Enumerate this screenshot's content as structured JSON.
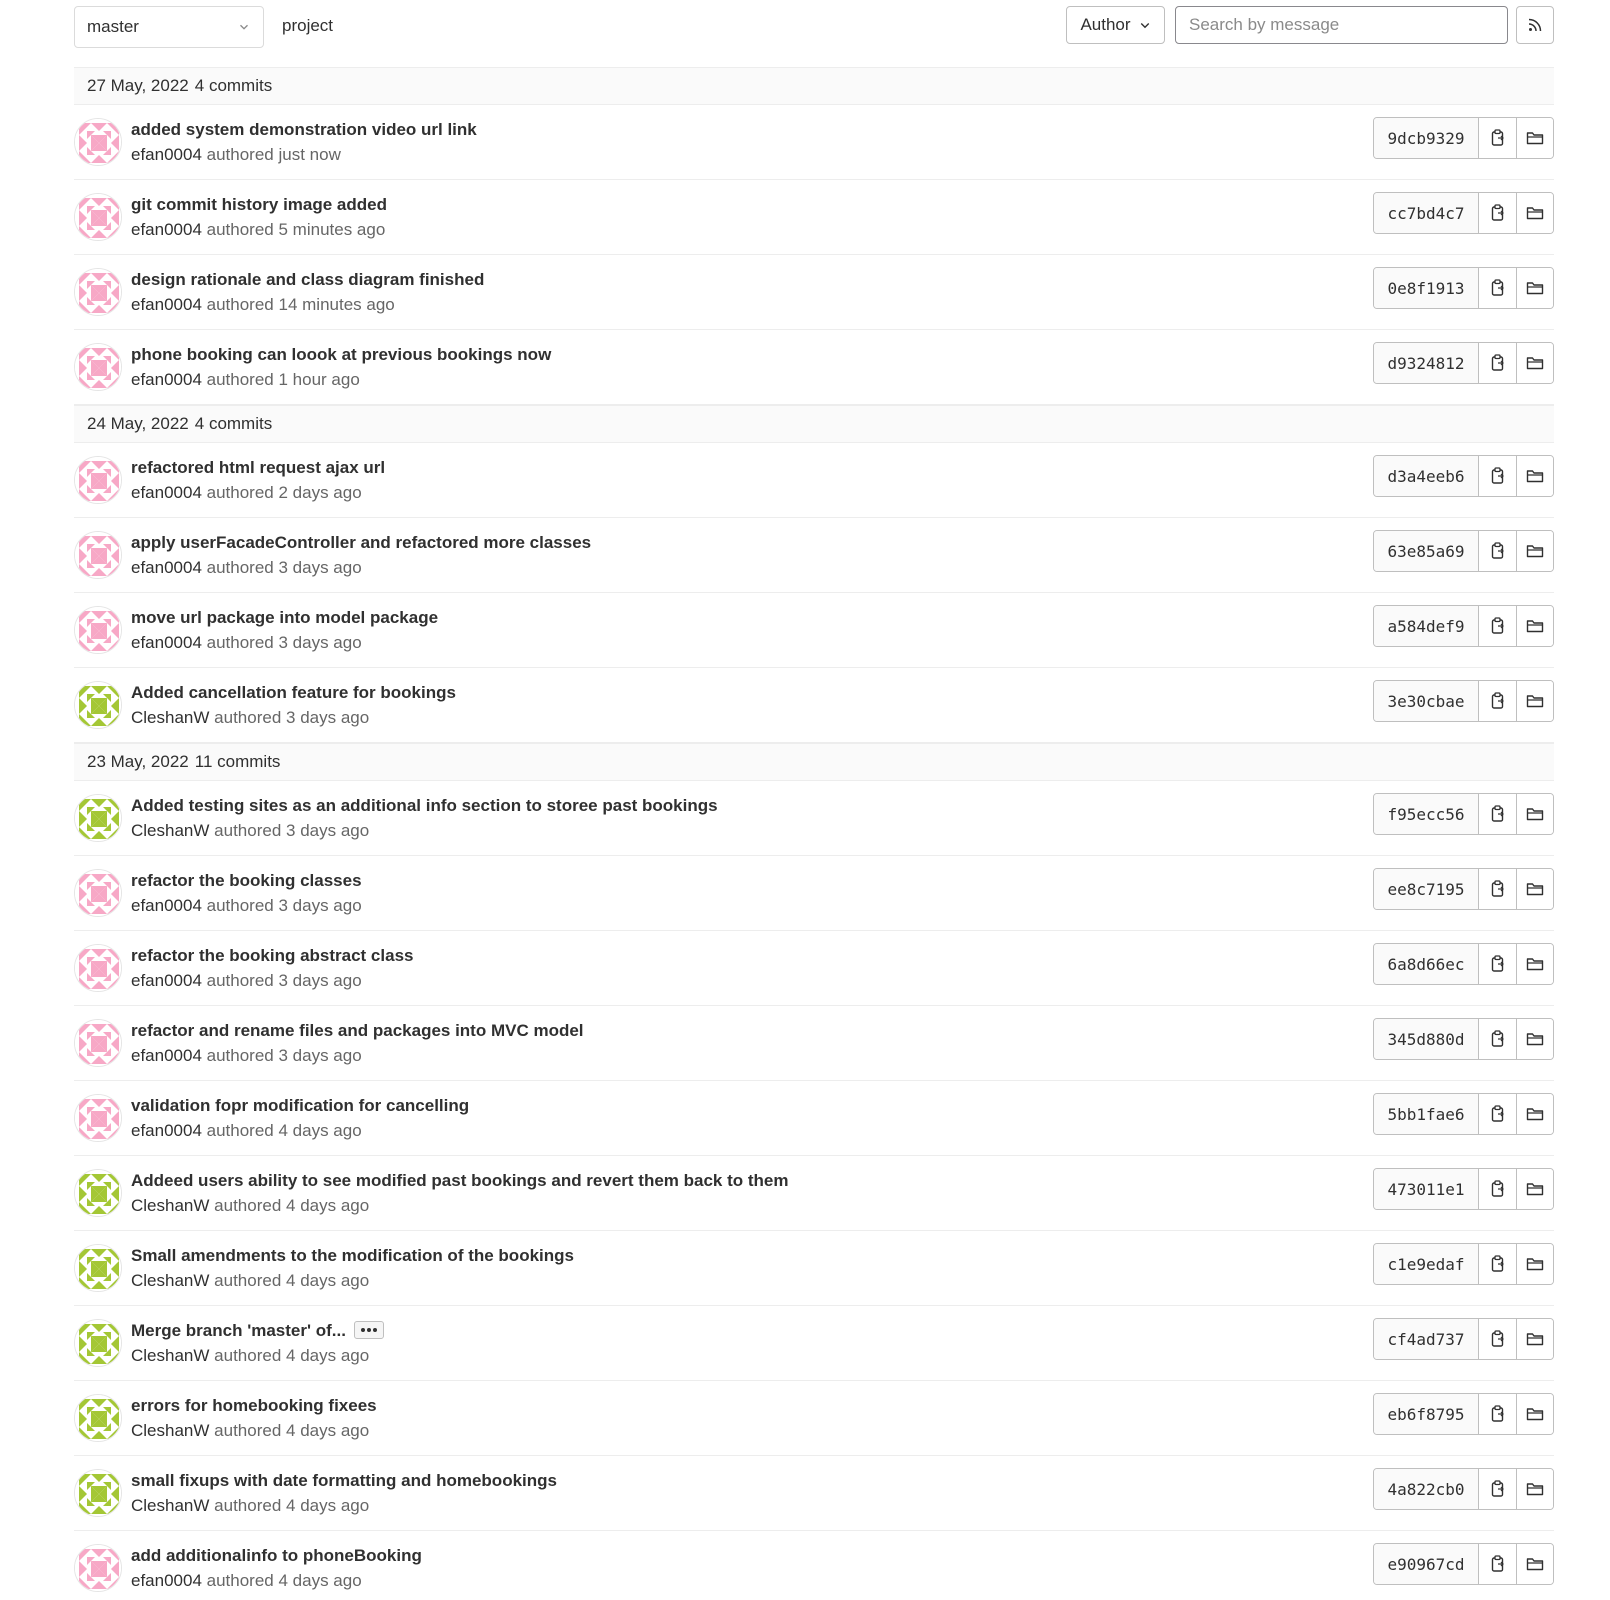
{
  "toolbar": {
    "branch": "master",
    "breadcrumb": "project",
    "author_label": "Author",
    "search_placeholder": "Search by message"
  },
  "colors": {
    "pink_avatar": "#f7a8c6",
    "green_avatar": "#a4c735"
  },
  "days": [
    {
      "date": "27 May, 2022",
      "count": "4 commits",
      "commits": [
        {
          "message": "added system demonstration video url link",
          "author": "efan0004",
          "verb": "authored",
          "time": "just now",
          "sha": "9dcb9329",
          "avatar": "pink"
        },
        {
          "message": "git commit history image added",
          "author": "efan0004",
          "verb": "authored",
          "time": "5 minutes ago",
          "sha": "cc7bd4c7",
          "avatar": "pink"
        },
        {
          "message": "design rationale and class diagram finished",
          "author": "efan0004",
          "verb": "authored",
          "time": "14 minutes ago",
          "sha": "0e8f1913",
          "avatar": "pink"
        },
        {
          "message": "phone booking can loook at previous bookings now",
          "author": "efan0004",
          "verb": "authored",
          "time": "1 hour ago",
          "sha": "d9324812",
          "avatar": "pink"
        }
      ]
    },
    {
      "date": "24 May, 2022",
      "count": "4 commits",
      "commits": [
        {
          "message": "refactored html request ajax url",
          "author": "efan0004",
          "verb": "authored",
          "time": "2 days ago",
          "sha": "d3a4eeb6",
          "avatar": "pink"
        },
        {
          "message": "apply userFacadeController and refactored more classes",
          "author": "efan0004",
          "verb": "authored",
          "time": "3 days ago",
          "sha": "63e85a69",
          "avatar": "pink"
        },
        {
          "message": "move url package into model package",
          "author": "efan0004",
          "verb": "authored",
          "time": "3 days ago",
          "sha": "a584def9",
          "avatar": "pink"
        },
        {
          "message": "Added cancellation feature for bookings",
          "author": "CleshanW",
          "verb": "authored",
          "time": "3 days ago",
          "sha": "3e30cbae",
          "avatar": "green"
        }
      ]
    },
    {
      "date": "23 May, 2022",
      "count": "11 commits",
      "commits": [
        {
          "message": "Added testing sites as an additional info section to storee past bookings",
          "author": "CleshanW",
          "verb": "authored",
          "time": "3 days ago",
          "sha": "f95ecc56",
          "avatar": "green"
        },
        {
          "message": "refactor the booking classes",
          "author": "efan0004",
          "verb": "authored",
          "time": "3 days ago",
          "sha": "ee8c7195",
          "avatar": "pink"
        },
        {
          "message": "refactor the booking abstract class",
          "author": "efan0004",
          "verb": "authored",
          "time": "3 days ago",
          "sha": "6a8d66ec",
          "avatar": "pink"
        },
        {
          "message": "refactor and rename files and packages into MVC model",
          "author": "efan0004",
          "verb": "authored",
          "time": "3 days ago",
          "sha": "345d880d",
          "avatar": "pink"
        },
        {
          "message": "validation fopr modification for cancelling",
          "author": "efan0004",
          "verb": "authored",
          "time": "4 days ago",
          "sha": "5bb1fae6",
          "avatar": "pink"
        },
        {
          "message": "Addeed users ability to see modified past bookings and revert them back to them",
          "author": "CleshanW",
          "verb": "authored",
          "time": "4 days ago",
          "sha": "473011e1",
          "avatar": "green"
        },
        {
          "message": "Small amendments to the modification of the bookings",
          "author": "CleshanW",
          "verb": "authored",
          "time": "4 days ago",
          "sha": "c1e9edaf",
          "avatar": "green"
        },
        {
          "message": "Merge branch 'master' of...",
          "author": "CleshanW",
          "verb": "authored",
          "time": "4 days ago",
          "sha": "cf4ad737",
          "avatar": "green",
          "has_ellipsis": true
        },
        {
          "message": "errors for homebooking fixees",
          "author": "CleshanW",
          "verb": "authored",
          "time": "4 days ago",
          "sha": "eb6f8795",
          "avatar": "green"
        },
        {
          "message": "small fixups with date formatting and homebookings",
          "author": "CleshanW",
          "verb": "authored",
          "time": "4 days ago",
          "sha": "4a822cb0",
          "avatar": "green"
        },
        {
          "message": "add additionalinfo to phoneBooking",
          "author": "efan0004",
          "verb": "authored",
          "time": "4 days ago",
          "sha": "e90967cd",
          "avatar": "pink"
        }
      ]
    }
  ]
}
